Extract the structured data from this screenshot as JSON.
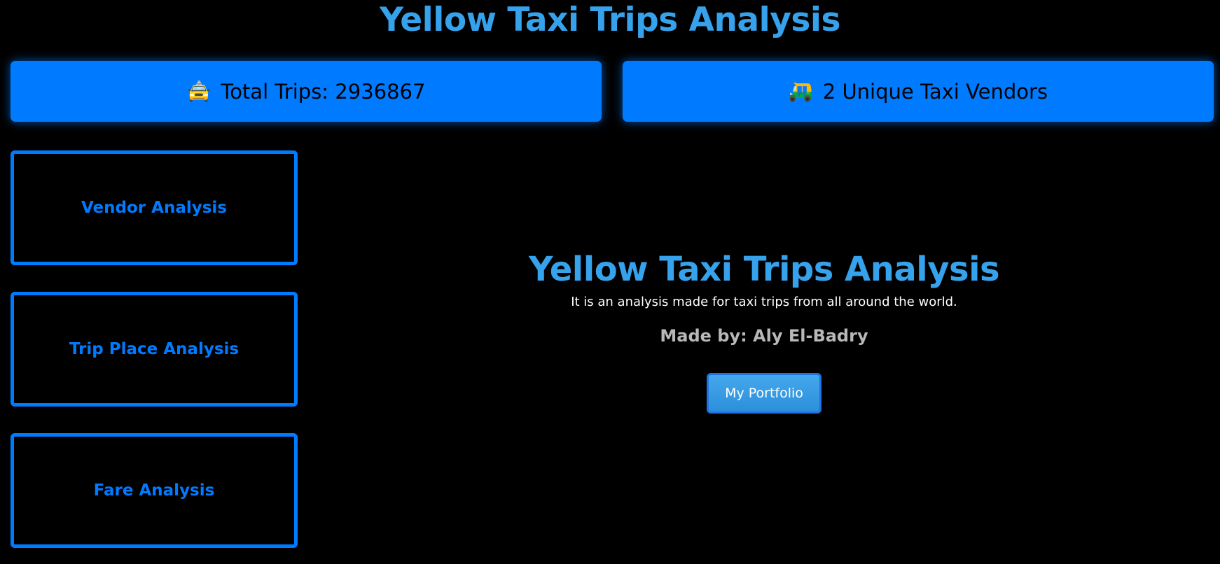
{
  "header": {
    "title": "Yellow Taxi Trips Analysis"
  },
  "stats": {
    "total_trips_icon": "🚖",
    "total_trips_text": "Total Trips: 2936867",
    "vendors_icon": "🛺",
    "vendors_text": "2 Unique Taxi Vendors"
  },
  "nav": {
    "items": [
      {
        "label": "Vendor Analysis"
      },
      {
        "label": "Trip Place Analysis"
      },
      {
        "label": "Fare Analysis"
      }
    ]
  },
  "hero": {
    "title": "Yellow Taxi Trips Analysis",
    "description": "It is an analysis made for taxi trips from all around the world.",
    "author": "Made by: Aly El-Badry",
    "button_label": "My Portfolio"
  },
  "colors": {
    "accent": "#007bff",
    "title": "#36a2eb",
    "background": "#000000"
  }
}
